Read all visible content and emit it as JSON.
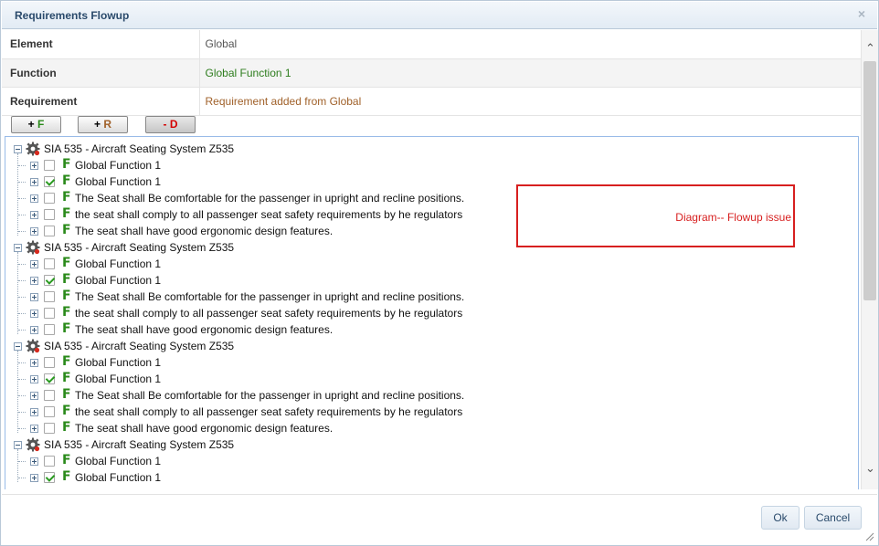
{
  "dialog": {
    "title": "Requirements Flowup",
    "close_glyph": "×"
  },
  "properties": [
    {
      "label": "Element",
      "value": "Global"
    },
    {
      "label": "Function",
      "value": "Global Function 1"
    },
    {
      "label": "Requirement",
      "value": "Requirement added from Global"
    }
  ],
  "toolbar": {
    "add_function": {
      "sign": "+",
      "letter": "F"
    },
    "add_requirement": {
      "sign": "+",
      "letter": "R"
    },
    "delete": {
      "sign": "-",
      "letter": "D"
    }
  },
  "tree": {
    "root_icon": "gear-icon",
    "child_icon": "function-f-icon",
    "groups": [
      {
        "root": "SIA 535 - Aircraft Seating System Z535",
        "children": [
          {
            "label": "Global Function 1",
            "checked": false
          },
          {
            "label": "Global Function 1",
            "checked": true
          },
          {
            "label": "The Seat shall Be comfortable for the passenger in upright and recline positions.",
            "checked": false
          },
          {
            "label": "the seat shall comply to all passenger seat safety requirements by he regulators",
            "checked": false
          },
          {
            "label": "The seat shall have good ergonomic design features.",
            "checked": false
          }
        ]
      },
      {
        "root": "SIA 535 - Aircraft Seating System Z535",
        "children": [
          {
            "label": "Global Function 1",
            "checked": false
          },
          {
            "label": "Global Function 1",
            "checked": true
          },
          {
            "label": "The Seat shall Be comfortable for the passenger in upright and recline positions.",
            "checked": false
          },
          {
            "label": "the seat shall comply to all passenger seat safety requirements by he regulators",
            "checked": false
          },
          {
            "label": "The seat shall have good ergonomic design features.",
            "checked": false
          }
        ]
      },
      {
        "root": "SIA 535 - Aircraft Seating System Z535",
        "children": [
          {
            "label": "Global Function 1",
            "checked": false
          },
          {
            "label": "Global Function 1",
            "checked": true
          },
          {
            "label": "The Seat shall Be comfortable for the passenger in upright and recline positions.",
            "checked": false
          },
          {
            "label": "the seat shall comply to all passenger seat safety requirements by he regulators",
            "checked": false
          },
          {
            "label": "The seat shall have good ergonomic design features.",
            "checked": false
          }
        ]
      },
      {
        "root": "SIA 535 - Aircraft Seating System Z535",
        "children": [
          {
            "label": "Global Function 1",
            "checked": false
          },
          {
            "label": "Global Function 1",
            "checked": true
          }
        ]
      }
    ]
  },
  "annotation": {
    "text": "Diagram-- Flowup issue",
    "color": "#d71f1f"
  },
  "footer": {
    "ok_label": "Ok",
    "cancel_label": "Cancel"
  },
  "colors": {
    "function_green": "#2e7d1e",
    "requirement_brown": "#a0612a",
    "delete_red": "#d40000"
  }
}
